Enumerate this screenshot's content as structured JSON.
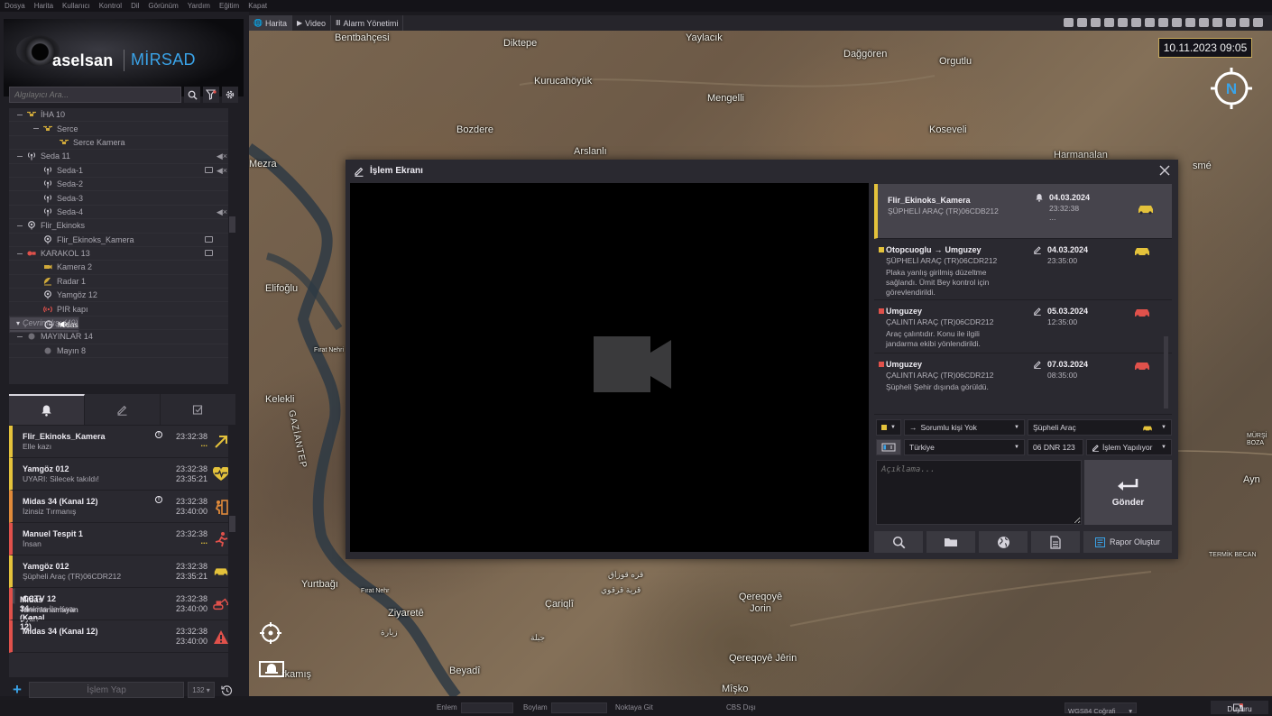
{
  "menubar": [
    "Dosya",
    "Harita",
    "Kullanıcı",
    "Kontrol",
    "Dil",
    "Görünüm",
    "Yardım",
    "Eğitim",
    "Kapat"
  ],
  "brand": {
    "company": "aselsan",
    "product": "MİRSAD"
  },
  "search": {
    "placeholder": "Algılayıcı Ara..."
  },
  "tree": [
    {
      "label": "İHA 10",
      "icon": "drone-icon",
      "level": 0,
      "toggle": true
    },
    {
      "label": "Serce",
      "icon": "drone-icon",
      "level": 1,
      "toggle": true
    },
    {
      "label": "Serce Kamera",
      "icon": "drone-icon",
      "level": 2,
      "toggle": false
    },
    {
      "label": "Seda 11",
      "icon": "antenna-icon",
      "level": 0,
      "toggle": true,
      "mute": true
    },
    {
      "label": "Seda-1",
      "icon": "antenna-icon",
      "level": 1,
      "toggle": false,
      "sub": true,
      "mute": true
    },
    {
      "label": "Seda-2",
      "icon": "antenna-icon",
      "level": 1,
      "toggle": false
    },
    {
      "label": "Seda-3",
      "icon": "antenna-icon",
      "level": 1,
      "toggle": false
    },
    {
      "label": "Seda-4",
      "icon": "antenna-icon",
      "level": 1,
      "toggle": false,
      "mute": true
    },
    {
      "label": "Flir_Ekinoks",
      "icon": "ptz-camera-icon",
      "level": 0,
      "toggle": true
    },
    {
      "label": "Flir_Ekinoks_Kamera",
      "icon": "ptz-camera-icon",
      "level": 1,
      "toggle": false,
      "sub": true
    },
    {
      "label": "KARAKOL 13",
      "icon": "outpost-icon",
      "level": 0,
      "toggle": true,
      "sub": true
    },
    {
      "label": "Kamera 2",
      "icon": "camera-icon",
      "level": 1,
      "toggle": false
    },
    {
      "label": "Radar 1",
      "icon": "radar-icon",
      "level": 1,
      "toggle": false
    },
    {
      "label": "Yamgöz 12",
      "icon": "ptz-camera-icon",
      "level": 1,
      "toggle": false
    },
    {
      "label": "PIR kapı",
      "icon": "pir-icon",
      "level": 1,
      "toggle": false
    },
    {
      "label": "Midas",
      "icon": "sensor-icon",
      "level": 1,
      "toggle": false,
      "selected": true,
      "mute": true
    },
    {
      "label": "Çevrimdışı (49)",
      "icon": "",
      "level": -1,
      "offline": true
    },
    {
      "label": "MAYINLAR 14",
      "icon": "mine-icon",
      "level": 0,
      "toggle": true
    },
    {
      "label": "Mayın 8",
      "icon": "mine-icon",
      "level": 1,
      "toggle": false
    }
  ],
  "alarm_tabs": [
    "bell-icon",
    "pencil-icon",
    "checkbox-icon"
  ],
  "alarms": [
    {
      "title": "Flir_Ekinoks_Kamera",
      "subtitle": "Elle kazı",
      "time1": "23:32:38",
      "time2": "...",
      "color": "yellow",
      "icon": "arrow-up-right-icon",
      "excl": true
    },
    {
      "title": "Yamgöz 012",
      "subtitle": "UYARI: Silecek takıldı!",
      "time1": "23:32:38",
      "time2": "23:35:21",
      "color": "yellow",
      "icon": "heart-pulse-icon"
    },
    {
      "title": "Midas 34 (Kanal 12)",
      "subtitle": "İzinsiz Tırmanış",
      "time1": "23:32:38",
      "time2": "23:40:00",
      "color": "orange",
      "icon": "climb-icon",
      "excl": true
    },
    {
      "title": "Manuel Tespit 1",
      "subtitle": "İnsan",
      "time1": "23:32:38",
      "time2": "...",
      "color": "red",
      "icon": "running-person-icon"
    },
    {
      "title": "Yamgöz 012",
      "subtitle": "Şüpheli Araç (TR)06CDR212",
      "time1": "23:32:38",
      "time2": "23:35:21",
      "color": "yellow",
      "icon": "car-icon"
    },
    {
      "title": "Midas 34 (Kanal 12)",
      "subtitle": "Tanımlanamayan Uyarı",
      "time1": "23:32:38",
      "time2": "23:40:00",
      "color": "red",
      "icon": "warning-icon",
      "selected": true
    },
    {
      "title": "CCTV 12",
      "subtitle": "Makina İle Kazı",
      "time1": "23:32:38",
      "time2": "23:40:00",
      "color": "red",
      "icon": "excavator-icon"
    },
    {
      "title": "Midas 34 (Kanal 12)",
      "subtitle": "",
      "time1": "23:32:38",
      "time2": "23:40:00",
      "color": "red",
      "icon": "warning-icon"
    }
  ],
  "bottom": {
    "action_label": "İşlem Yap",
    "count": "132 ▾"
  },
  "map_tabs": [
    {
      "label": "Harita",
      "glyph": "🌐",
      "active": true
    },
    {
      "label": "Video",
      "glyph": "▶",
      "active": false
    },
    {
      "label": "Alarm Yönetimi",
      "glyph": "Ⅲ",
      "active": false
    }
  ],
  "map": {
    "datetime": "10.11.2023 09:05",
    "compass_letter": "N",
    "places": [
      {
        "name": "Bentbahçesi"
      },
      {
        "name": "Diktepe"
      },
      {
        "name": "Yaylacık"
      },
      {
        "name": "Dağgören"
      },
      {
        "name": "Orgutlu"
      },
      {
        "name": "Kurucahöyük"
      },
      {
        "name": "Mengelli"
      },
      {
        "name": "Bozdere"
      },
      {
        "name": "Koseveli"
      },
      {
        "name": "Arslanlı"
      },
      {
        "name": "Mezra"
      },
      {
        "name": "Harmanalan"
      },
      {
        "name": "smé"
      },
      {
        "name": "Elifoğlu"
      },
      {
        "name": "Kelekli"
      },
      {
        "name": "GAZİANTEP"
      },
      {
        "name": "Fırat Nehri"
      },
      {
        "name": "Yurtbağı"
      },
      {
        "name": "Fırat Nehr"
      },
      {
        "name": "Çariqlî"
      },
      {
        "name": "Ziyaretê"
      },
      {
        "name": "Qereqoyê Jorin"
      },
      {
        "name": "Qereqoyê Jêrin"
      },
      {
        "name": "Beyadî"
      },
      {
        "name": "rkamış"
      },
      {
        "name": "Mîşko"
      },
      {
        "name": "Ayn"
      },
      {
        "name": "MÜRŞİ BOZA"
      },
      {
        "name": "TERMİK BECAN"
      }
    ],
    "arabic": [
      "قرية قرقوي",
      "قره قوزاق",
      "زيارة",
      "جبلة"
    ]
  },
  "dialog": {
    "title": "İşlem Ekranı",
    "entries": [
      {
        "name": "Flir_Ekinoks_Kamera",
        "plate": "ŞÜPHELİ ARAÇ (TR)06CDB212",
        "date": "04.03.2024",
        "time": "23:32:38",
        "dots": "...",
        "icon": "bell-icon",
        "car_color": "#e4c23b",
        "first": true
      },
      {
        "from": "Otopcuoglu",
        "to": "Umguzey",
        "plate": "ŞÜPHELİ ARAÇ (TR)06CDR212",
        "date": "04.03.2024",
        "time": "23:35:00",
        "note": "Plaka yanlış girilmiş düzeltme sağlandı. Ümit Bey kontrol için görevlendirildi.",
        "icon": "pencil-icon",
        "car_color": "#e4c23b",
        "sq_color": "#e4c23b"
      },
      {
        "name": "Umguzey",
        "plate": "ÇALINTI ARAÇ (TR)06CDR212",
        "date": "05.03.2024",
        "time": "12:35:00",
        "note": "Araç çalıntıdır. Konu ile ilgili jandarma ekibi yönlendirildi.",
        "icon": "pencil-icon",
        "car_color": "#e0514b",
        "sq_color": "#e0514b"
      },
      {
        "name": "Umguzey",
        "plate": "ÇALINTI ARAÇ (TR)06CDR212",
        "date": "07.03.2024",
        "time": "08:35:00",
        "note": "Şüpheli Şehir dışında görüldü.",
        "icon": "pencil-icon",
        "car_color": "#e0514b",
        "sq_color": "#e0514b"
      }
    ],
    "form": {
      "responsible": "Sorumlu kişi Yok",
      "category": "Şüpheli Araç",
      "country": "Türkiye",
      "plate": "06 DNR 123",
      "status": "İşlem Yapılıyor",
      "desc_placeholder": "Açıklama...",
      "send_label": "Gönder"
    },
    "report_label": "Rapor Oluştur"
  },
  "statusbar": {
    "lat_label": "Enlem",
    "lon_label": "Boylam",
    "goto_label": "Noktaya Git",
    "cbs_label": "CBS Dışı",
    "crs": "WGS84 Coğrafi",
    "notice": "Duyuru"
  },
  "colors": {
    "accent": "#3aa3e8",
    "yellow": "#e4c23b",
    "orange": "#e08a3a",
    "red": "#e0514b",
    "panel": "#2a2930"
  }
}
